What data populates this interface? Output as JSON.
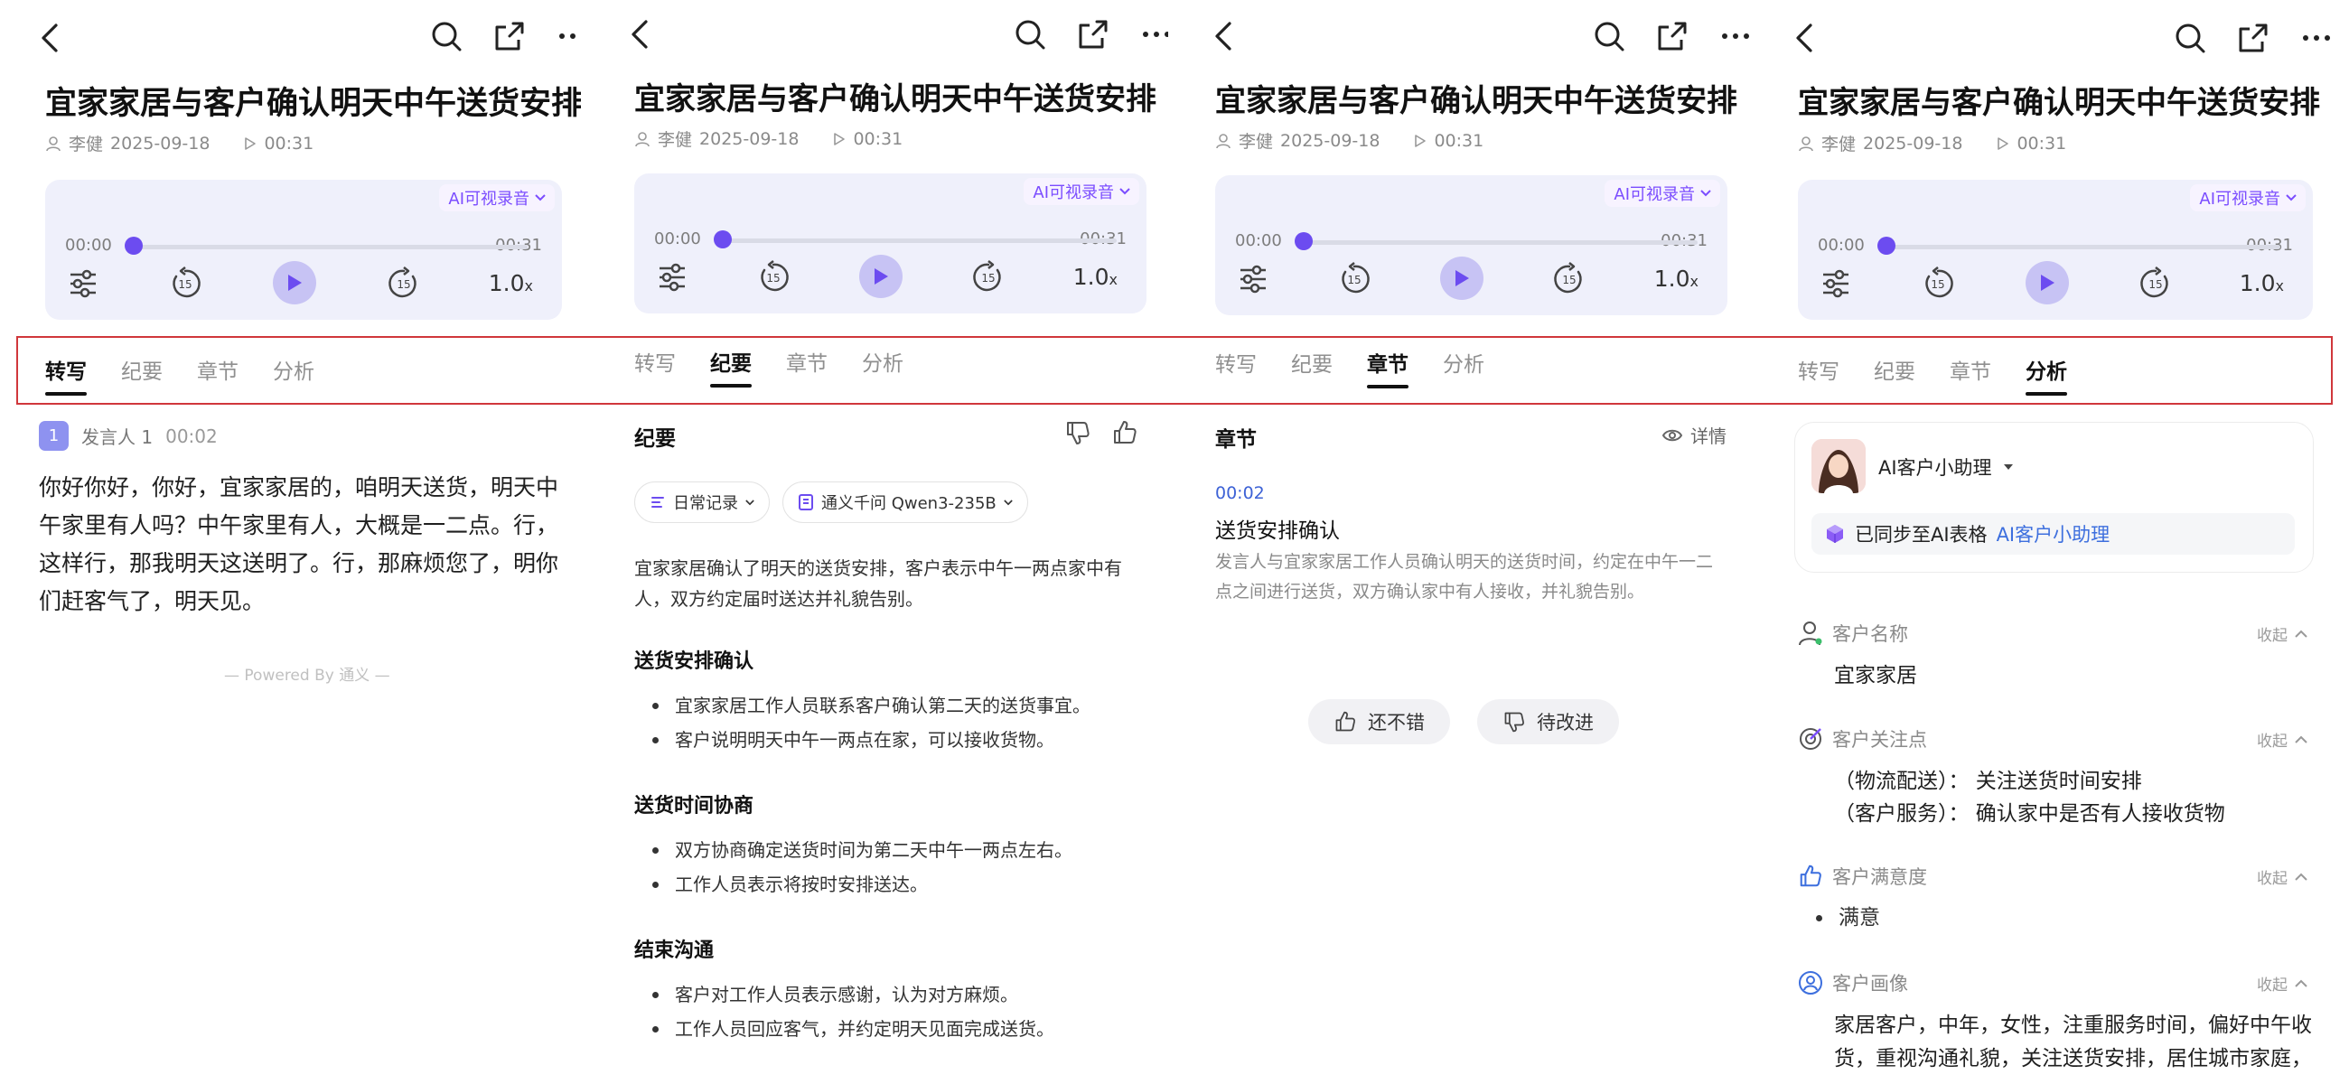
{
  "meeting": {
    "title": "宜家家居与客户确认明天中午送货安排",
    "author": "李健",
    "date": "2025-09-18",
    "duration": "00:31"
  },
  "player": {
    "ai_tag": "AI可视录音",
    "current_time": "00:00",
    "total_time": "00:31",
    "progress": 0,
    "speed_value": "1.0",
    "speed_unit": "x"
  },
  "tabs": [
    "转写",
    "纪要",
    "章节",
    "分析"
  ],
  "transcript": {
    "speaker_badge": "1",
    "speaker_name": "发言人 1",
    "speaker_time": "00:02",
    "text": "你好你好，你好，宜家家居的，咱明天送货，明天中午家里有人吗？中午家里有人，大概是一二点。行，这样行，那我明天这送明了。行，那麻烦您了，明你们赶客气了，明天见。",
    "powered": "— Powered By 通义 —"
  },
  "summary": {
    "heading": "纪要",
    "chip_template": "日常记录",
    "chip_model": "通义千问 Qwen3-235B",
    "intro": "宜家家居确认了明天的送货安排，客户表示中午一两点家中有人，双方约定届时送达并礼貌告别。",
    "sections": [
      {
        "title": "送货安排确认",
        "items": [
          "宜家家居工作人员联系客户确认第二天的送货事宜。",
          "客户说明明天中午一两点在家，可以接收货物。"
        ]
      },
      {
        "title": "送货时间协商",
        "items": [
          "双方协商确定送货时间为第二天中午一两点左右。",
          "工作人员表示将按时安排送达。"
        ]
      },
      {
        "title": "结束沟通",
        "items": [
          "客户对工作人员表示感谢，认为对方麻烦。",
          "工作人员回应客气，并约定明天见面完成送货。"
        ]
      }
    ]
  },
  "chapters": {
    "heading": "章节",
    "details": "详情",
    "time": "00:02",
    "title": "送货安排确认",
    "desc": "发言人与宜家家居工作人员确认明天的送货时间，约定在中午一二点之间进行送货，双方确认家中有人接收，并礼貌告别。",
    "good": "还不错",
    "improve": "待改进"
  },
  "analysis": {
    "assistant": "AI客户小助理",
    "sync_text": "已同步至AI表格",
    "sync_link": "AI客户小助理",
    "collapse": "收起",
    "fields": [
      {
        "label": "客户名称",
        "values": [
          "宜家家居"
        ]
      },
      {
        "label": "客户关注点",
        "values": [
          "（物流配送）： 关注送货时间安排",
          "（客户服务）： 确认家中是否有人接收货物"
        ]
      },
      {
        "label": "客户满意度",
        "values": [
          "满意"
        ]
      },
      {
        "label": "客户画像",
        "values": [
          "家居客户，中年，女性，注重服务时间，偏好中午收货，重视沟通礼貌，关注送货安排，居住城市家庭，"
        ]
      }
    ]
  },
  "colors": {
    "accent": "#6c4cf0",
    "highlight": "#d0373b",
    "link": "#3d6fde"
  }
}
